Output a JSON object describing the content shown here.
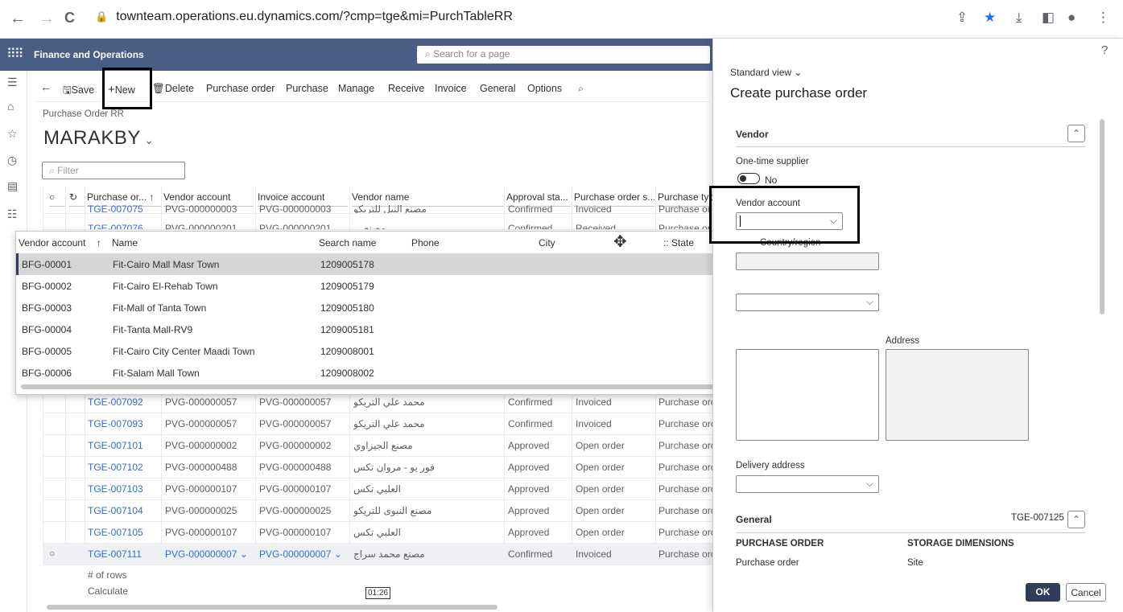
{
  "browser": {
    "back": "←",
    "forward": "→",
    "reload": "C",
    "url": "townteam.operations.eu.dynamics.com/?cmp=tge&mi=PurchTableRR"
  },
  "app": {
    "title": "Finance and Operations",
    "search_placeholder": "Search for a page"
  },
  "actions": {
    "save": "Save",
    "new": "New",
    "delete": "Delete",
    "tabs": [
      "Purchase order",
      "Purchase",
      "Manage",
      "Receive",
      "Invoice",
      "General",
      "Options"
    ]
  },
  "page": {
    "breadcrumb": "Purchase Order RR",
    "company": "MARAKBY",
    "filter_placeholder": "Filter"
  },
  "grid": {
    "columns": [
      "Purchase or...",
      "Vendor account",
      "Invoice account",
      "Vendor name",
      "Approval sta...",
      "Purchase order s...",
      "Purchase type"
    ],
    "top_partial_rows": [
      {
        "po": "TGE-007075",
        "vendor": "PVG-000000003",
        "invoice": "PVG-000000003",
        "name": "مصنع النيل للتريكو",
        "approval": "Confirmed",
        "status": "Invoiced",
        "type": "Purchase or"
      },
      {
        "po": "TGE-007076",
        "vendor": "PVG-000000201",
        "invoice": "PVG-000000201",
        "name": "مصنع ...",
        "approval": "Confirmed",
        "status": "Received",
        "type": "Purchase or"
      }
    ],
    "rows": [
      {
        "po": "TGE-007092",
        "vendor": "PVG-000000057",
        "invoice": "PVG-000000057",
        "name": "محمد علي التريكو",
        "approval": "Confirmed",
        "status": "Invoiced",
        "type": "Purchase orc"
      },
      {
        "po": "TGE-007093",
        "vendor": "PVG-000000057",
        "invoice": "PVG-000000057",
        "name": "محمد علي التريكو",
        "approval": "Confirmed",
        "status": "Invoiced",
        "type": "Purchase orc"
      },
      {
        "po": "TGE-007101",
        "vendor": "PVG-000000002",
        "invoice": "PVG-000000002",
        "name": "مصنع الجيزاوي",
        "approval": "Approved",
        "status": "Open order",
        "type": "Purchase orc"
      },
      {
        "po": "TGE-007102",
        "vendor": "PVG-000000488",
        "invoice": "PVG-000000488",
        "name": "فور يو - مروان تكس",
        "approval": "Approved",
        "status": "Open order",
        "type": "Purchase orc"
      },
      {
        "po": "TGE-007103",
        "vendor": "PVG-000000107",
        "invoice": "PVG-000000107",
        "name": "العلبي تكس",
        "approval": "Approved",
        "status": "Open order",
        "type": "Purchase orc"
      },
      {
        "po": "TGE-007104",
        "vendor": "PVG-000000025",
        "invoice": "PVG-000000025",
        "name": "مصنع النبوى للتريكو",
        "approval": "Approved",
        "status": "Open order",
        "type": "Purchase orc"
      },
      {
        "po": "TGE-007105",
        "vendor": "PVG-000000107",
        "invoice": "PVG-000000107",
        "name": "العلبي تكس",
        "approval": "Approved",
        "status": "Open order",
        "type": "Purchase orc"
      },
      {
        "po": "TGE-007111",
        "vendor": "PVG-000000007",
        "invoice": "PVG-000000007",
        "name": "مصنع محمد سراج",
        "approval": "Confirmed",
        "status": "Invoiced",
        "type": "Purchase orc"
      }
    ],
    "footer_rows": "# of rows",
    "footer_calc": "Calculate",
    "time": "01:26"
  },
  "lookup": {
    "columns": [
      "Vendor account",
      "Name",
      "Search name",
      "Phone",
      "City",
      "State"
    ],
    "rows": [
      {
        "account": "BFG-00001",
        "name": "Fit-Cairo Mall Masr Town",
        "search": "1209005178"
      },
      {
        "account": "BFG-00002",
        "name": "Fit-Cairo El-Rehab Town",
        "search": "1209005179"
      },
      {
        "account": "BFG-00003",
        "name": "Fit-Mall of Tanta Town",
        "search": "1209005180"
      },
      {
        "account": "BFG-00004",
        "name": "Fit-Tanta Mall-RV9",
        "search": "1209005181"
      },
      {
        "account": "BFG-00005",
        "name": "Fit-Cairo City Center Maadi Town",
        "search": "1209008001"
      },
      {
        "account": "BFG-00006",
        "name": "Fit-Salam Mall Town",
        "search": "1209008002"
      }
    ]
  },
  "panel": {
    "help": "?",
    "view": "Standard view",
    "title": "Create purchase order",
    "vendor_section": "Vendor",
    "one_time_label": "One-time supplier",
    "one_time_value": "No",
    "vendor_account_label": "Vendor account",
    "country_label": "Country/region",
    "address_label": "Address",
    "delivery_label": "Delivery address",
    "general_section": "General",
    "general_po": "TGE-007125",
    "po_heading": "PURCHASE ORDER",
    "storage_heading": "STORAGE DIMENSIONS",
    "po_field": "Purchase order",
    "site_field": "Site",
    "ok": "OK",
    "cancel": "Cancel"
  }
}
